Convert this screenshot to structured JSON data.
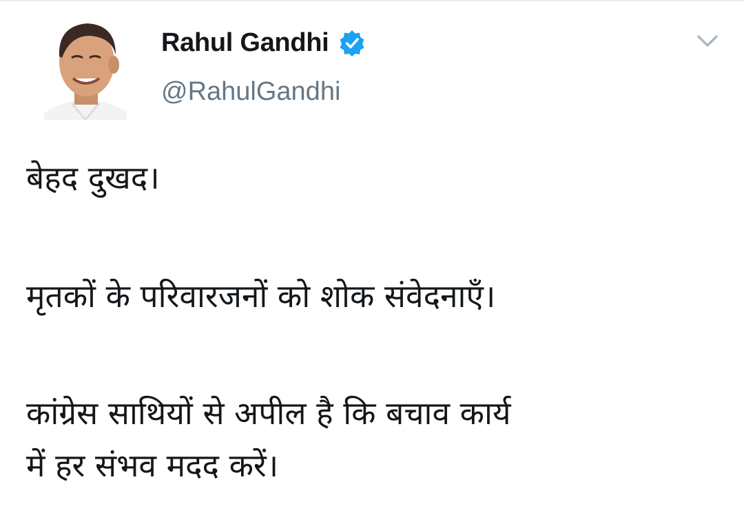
{
  "author": {
    "display_name": "Rahul Gandhi",
    "handle": "@RahulGandhi",
    "verified": true,
    "avatar_icon": "profile-photo",
    "verified_icon": "verified-badge-icon",
    "menu_icon": "chevron-down-icon"
  },
  "tweet": {
    "lines": [
      "बेहद दुखद।",
      "मृतकों के परिवारजनों को शोक संवेदनाएँ।",
      "कांग्रेस साथियों से अपील है कि बचाव कार्य",
      "में हर संभव मदद करें।"
    ]
  },
  "colors": {
    "name": "#14171a",
    "handle": "#657786",
    "verified": "#1da1f2",
    "caret": "#aab8c2",
    "text": "#14171a"
  }
}
